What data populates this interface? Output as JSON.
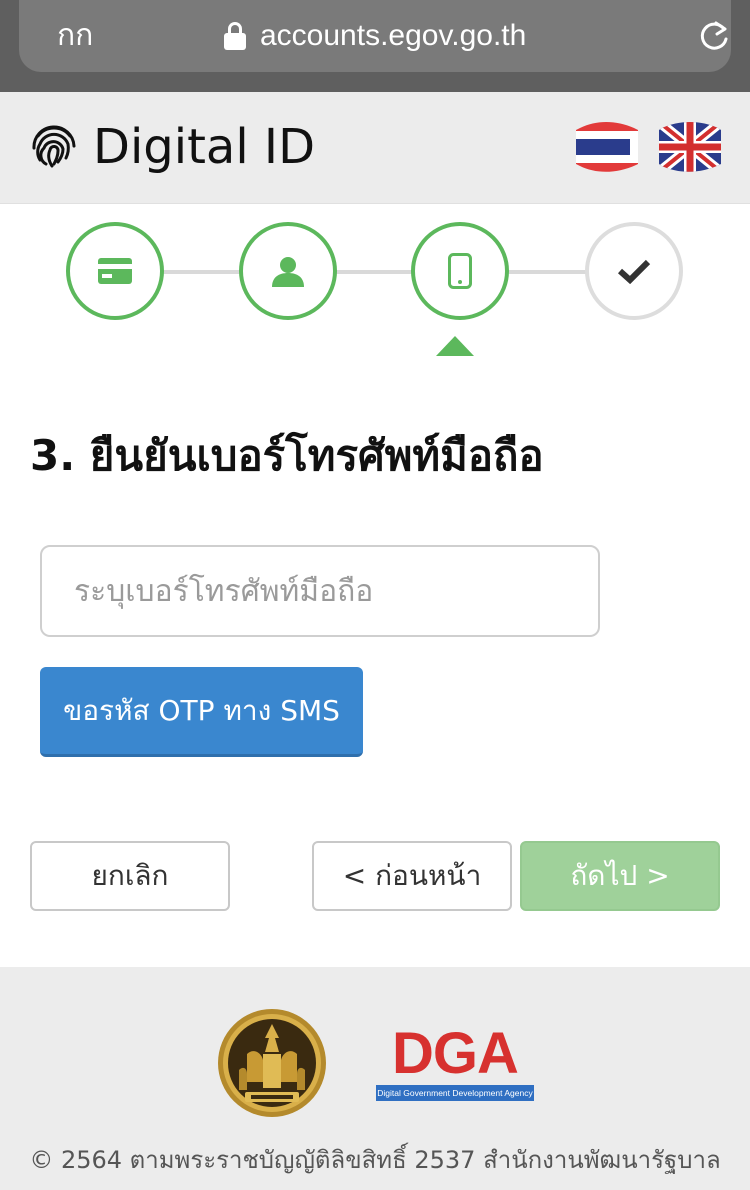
{
  "browser": {
    "reader_label": "กก",
    "url": "accounts.egov.go.th"
  },
  "header": {
    "title": "Digital ID",
    "languages": [
      "thai-flag-icon",
      "uk-flag-icon"
    ]
  },
  "stepper": {
    "steps": [
      {
        "icon": "id-card-icon",
        "state": "complete"
      },
      {
        "icon": "user-icon",
        "state": "complete"
      },
      {
        "icon": "mobile-phone-icon",
        "state": "active"
      },
      {
        "icon": "checkmark-icon",
        "state": "pending"
      }
    ],
    "active_index": 2
  },
  "main": {
    "title": "3. ยืนยันเบอร์โทรศัพท์มือถือ",
    "phone_placeholder": "ระบุเบอร์โทรศัพท์มือถือ",
    "phone_value": "",
    "otp_button": "ขอรหัส OTP ทาง SMS"
  },
  "nav": {
    "cancel": "ยกเลิก",
    "previous": "< ก่อนหน้า",
    "next": "ถัดไป >"
  },
  "footer": {
    "dga_logo_text": "DGA",
    "dga_tagline": "Digital Government Development Agency",
    "copyright": "© 2564 ตามพระราชบัญญัติลิขสิทธิ์ 2537 สำนักงานพัฒนารัฐบาล"
  },
  "colors": {
    "accent_green": "#5cb85c",
    "primary_blue": "#3a87cf",
    "disabled_green": "#9fd19a",
    "dga_red": "#d7312f"
  }
}
